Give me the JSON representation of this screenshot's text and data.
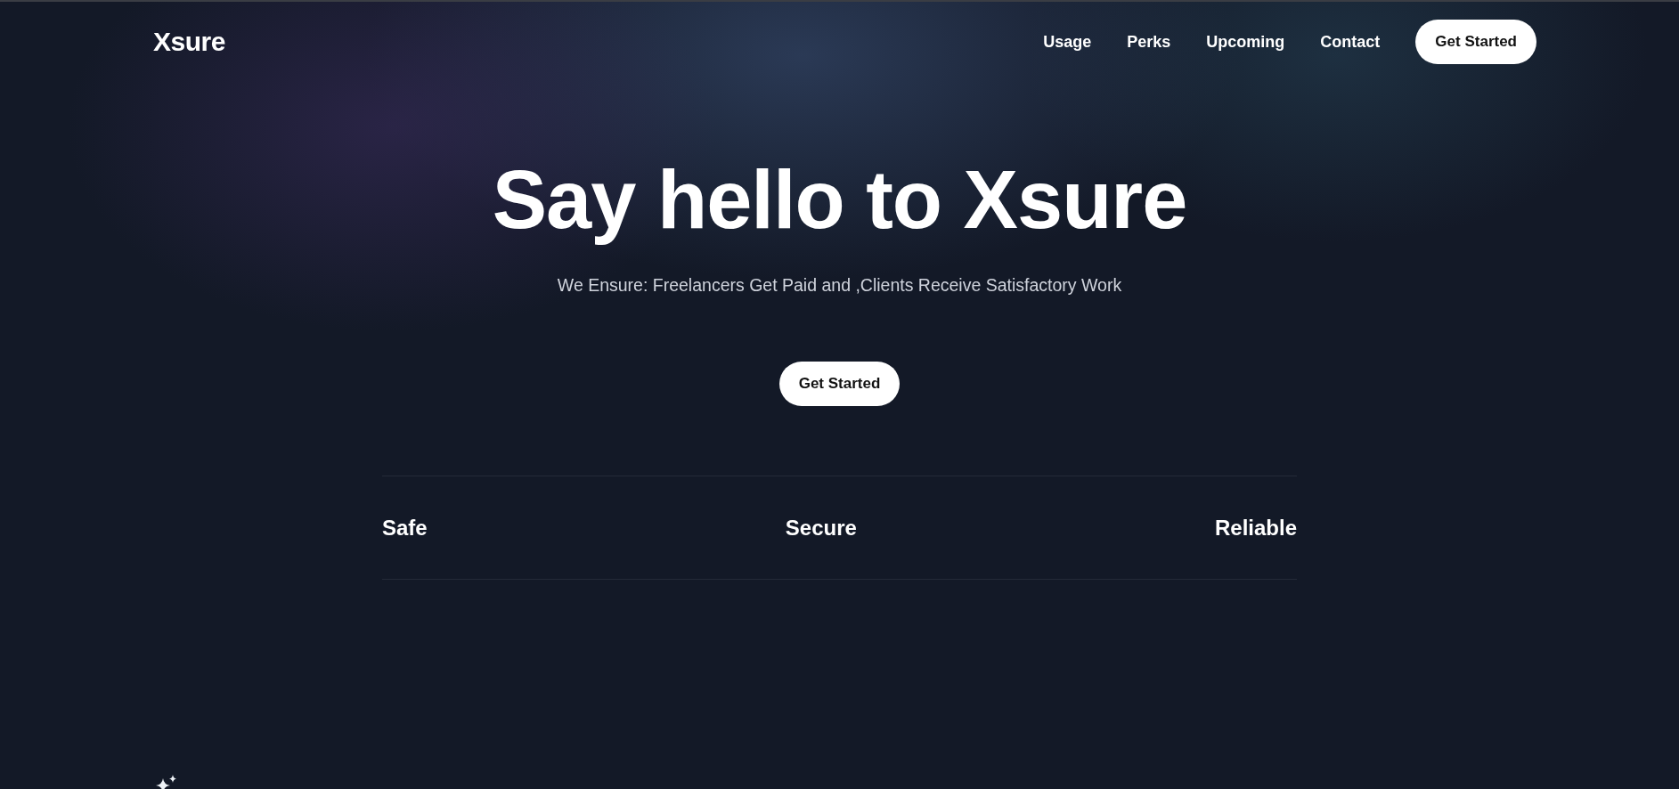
{
  "header": {
    "logo": "Xsure",
    "nav": [
      "Usage",
      "Perks",
      "Upcoming",
      "Contact"
    ],
    "cta": "Get Started"
  },
  "hero": {
    "title": "Say hello to Xsure",
    "subtitle": "We Ensure: Freelancers Get Paid and ,Clients Receive Satisfactory Work",
    "cta": "Get Started"
  },
  "features": [
    "Safe",
    "Secure",
    "Reliable"
  ]
}
